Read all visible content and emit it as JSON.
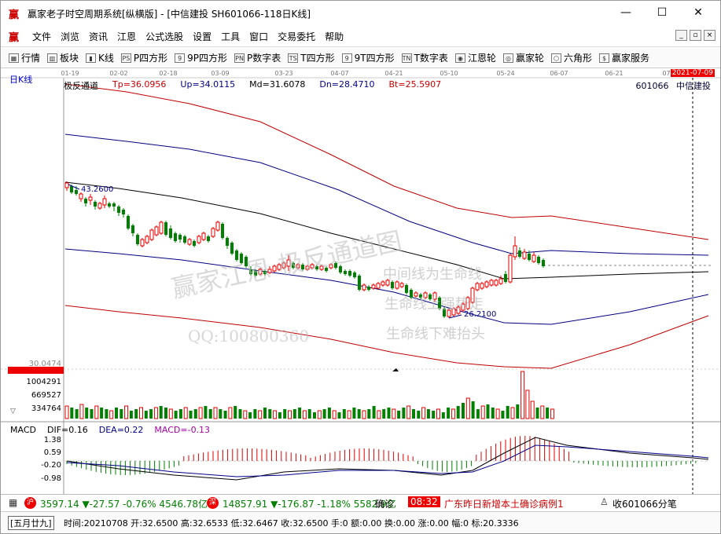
{
  "window": {
    "app_icon": "赢",
    "title": "赢家老子时空周期系统[纵横版] - [中信建投  SH601066-118日K线]",
    "minimize": "—",
    "maximize": "☐",
    "close": "✕"
  },
  "menu": {
    "logo": "赢",
    "items": [
      "文件",
      "浏览",
      "资讯",
      "江恩",
      "公式选股",
      "设置",
      "工具",
      "窗口",
      "交易委托",
      "帮助"
    ],
    "mdi": [
      "_",
      "▫",
      "×"
    ]
  },
  "toolbar": {
    "items": [
      {
        "icon": "grid-icon",
        "glyph": "▦",
        "label": "行情"
      },
      {
        "icon": "blocks-icon",
        "glyph": "▥",
        "label": "板块"
      },
      {
        "icon": "kline-icon",
        "glyph": "▮",
        "label": "K线"
      },
      {
        "icon": "p-square-icon",
        "glyph": "PS",
        "label": "P四方形"
      },
      {
        "icon": "nine-p-icon",
        "glyph": "9",
        "label": "9P四方形"
      },
      {
        "icon": "pn-icon",
        "glyph": "PN",
        "label": "P数字表"
      },
      {
        "icon": "ts-icon",
        "glyph": "TS",
        "label": "T四方形"
      },
      {
        "icon": "nine-t-icon",
        "glyph": "9",
        "label": "9T四方形"
      },
      {
        "icon": "tn-icon",
        "glyph": "TN",
        "label": "T数字表"
      },
      {
        "icon": "gann-wheel-icon",
        "glyph": "◉",
        "label": "江恩轮"
      },
      {
        "icon": "winner-wheel-icon",
        "glyph": "◎",
        "label": "赢家轮"
      },
      {
        "icon": "hexagon-icon",
        "glyph": "⬡",
        "label": "六角形"
      },
      {
        "icon": "dollar-icon",
        "glyph": "$",
        "label": "赢家服务"
      }
    ]
  },
  "chart": {
    "period_label": "日K线",
    "date_ticks": [
      "01-19",
      "02-02",
      "02-18",
      "03-09",
      "03-23",
      "04-07",
      "04-21",
      "05-10",
      "05-24",
      "06-07",
      "06-21",
      "07-"
    ],
    "date_highlight": "2021-07-09",
    "indicator": {
      "name": "极反通道",
      "tp": "Tp=36.0956",
      "up": "Up=34.0115",
      "md": "Md=31.6078",
      "dn": "Dn=28.4710",
      "bt": "Bt=25.5907"
    },
    "stock_code": "601066",
    "stock_name": "中信建投",
    "high_label": "43.2600",
    "low_label": "26.2100",
    "watermark_main": "赢家江恩  极反通道图",
    "watermark_lines": [
      "中间线为生命线",
      "生命线上强势走",
      "生命线下难抬头"
    ],
    "watermark_qq": "QQ:100800360",
    "volume_price_label": "30.0474",
    "volume_ticks": [
      "1004291",
      "669527",
      "334764"
    ],
    "scroll_down": "▽",
    "colors": {
      "up": "#e00000",
      "down": "#008000",
      "top_band": "#c00000",
      "mid_band": "#000080",
      "mid_line": "#000000"
    }
  },
  "macd": {
    "name": "MACD",
    "dif": "DIF=0.16",
    "dea": "DEA=0.22",
    "macd": "MACD=-0.13",
    "ticks": [
      "1.38",
      "0.59",
      "-0.20",
      "-0.98"
    ]
  },
  "status": {
    "sh_badge": "沪",
    "sh_text": "3597.14 ▼-27.57 -0.76% 4546.78亿",
    "sz_badge": "深",
    "sz_text": "14857.91 ▼-176.87 -1.18% 5582.9亿",
    "news_time": "08:32",
    "news_text": "广东昨日新增本土确诊病例1",
    "collect_text": "收601066分笔",
    "truncated": "确诊",
    "lunar": "[五月廿九]",
    "quote": "时间:20210708 开:32.6500 高:32.6533 低:32.6467 收:32.6500 手:0 额:0.00 换:0.00 涨:0.00 幅:0 标:20.3336"
  }
}
